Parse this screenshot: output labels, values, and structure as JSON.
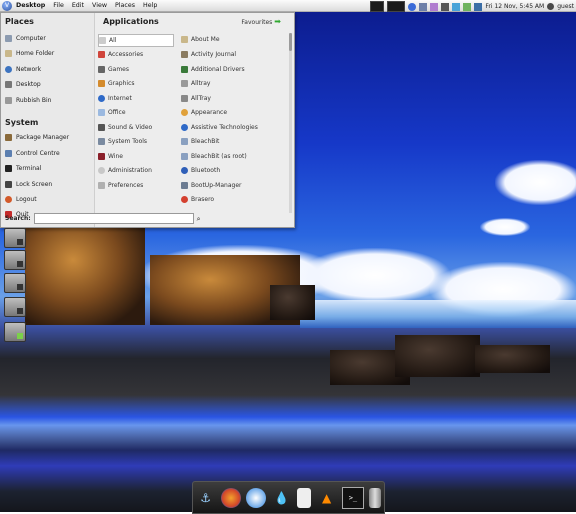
{
  "panel": {
    "menus": [
      "Desktop",
      "File",
      "Edit",
      "View",
      "Places",
      "Help"
    ],
    "clock": "Fri 12 Nov,  5:45 AM",
    "user": "guest",
    "tray_icons": [
      "bluetooth-icon",
      "network-icon",
      "volume-icon",
      "mail-icon",
      "battery-icon",
      "chat-icon"
    ]
  },
  "places": {
    "title": "Places",
    "items": [
      "Computer",
      "Home Folder",
      "Network",
      "Desktop",
      "Rubbish Bin"
    ]
  },
  "system": {
    "title": "System",
    "items": [
      "Package Manager",
      "Control Centre",
      "Terminal",
      "Lock Screen",
      "Logout",
      "Quit"
    ]
  },
  "applications": {
    "title": "Applications",
    "favourites": "Favourites",
    "categories": [
      "All",
      "Accessories",
      "Games",
      "Graphics",
      "Internet",
      "Office",
      "Sound & Video",
      "System Tools",
      "Wine",
      "Administration",
      "Preferences"
    ],
    "apps": [
      "About Me",
      "Activity Journal",
      "Additional Drivers",
      "Alltray",
      "AllTray",
      "Appearance",
      "Assistive Technologies",
      "BleachBit",
      "BleachBit (as root)",
      "Bluetooth",
      "BootUp-Manager",
      "Brasero"
    ]
  },
  "search": {
    "label": "Search:",
    "placeholder": ""
  },
  "dock": [
    "anchor-icon",
    "firefox-icon",
    "thunderbird-icon",
    "water-drop-icon",
    "ipod-icon",
    "vlc-icon",
    "terminal-icon",
    "trash-icon"
  ]
}
